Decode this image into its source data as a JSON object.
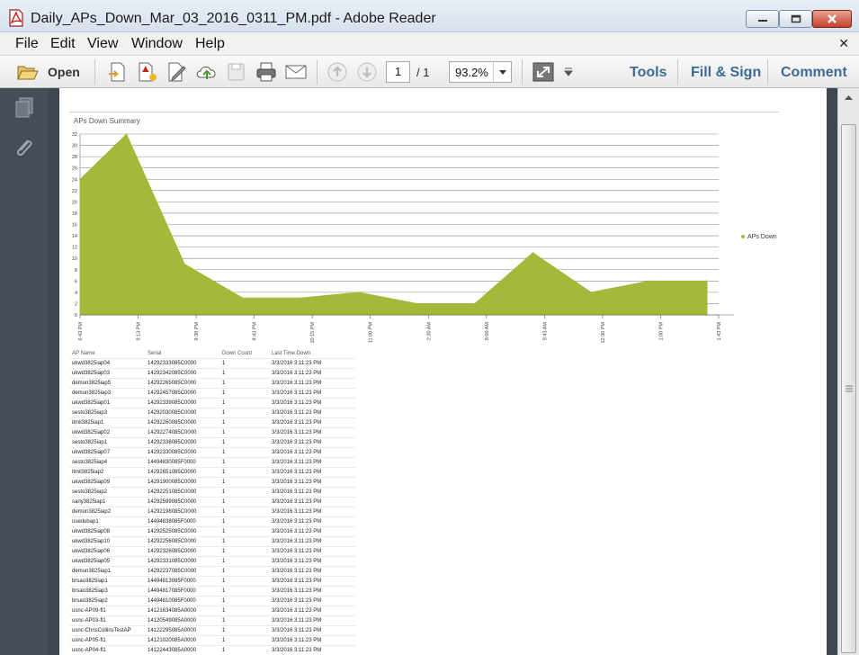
{
  "window": {
    "title": "Daily_APs_Down_Mar_03_2016_0311_PM.pdf - Adobe Reader"
  },
  "menu": [
    "File",
    "Edit",
    "View",
    "Window",
    "Help"
  ],
  "toolbar": {
    "open_label": "Open",
    "page_current": "1",
    "page_total": "/ 1",
    "zoom": "93.2%",
    "tools": "Tools",
    "fill_sign": "Fill & Sign",
    "comment": "Comment"
  },
  "chart_data": {
    "type": "area",
    "title": "APs Down Summary",
    "x_ticks": [
      "6:43 PM",
      "9:13 PM",
      "9:38 PM",
      "9:43 PM",
      "10:15 PM",
      "11:00 PM",
      "2:30 AM",
      "8:00 AM",
      "9:43 AM",
      "12:30 PM",
      "1:00 PM",
      "1:43 PM"
    ],
    "y_ticks": [
      0,
      2,
      4,
      6,
      8,
      10,
      12,
      14,
      16,
      18,
      20,
      22,
      24,
      26,
      28,
      30,
      32
    ],
    "ylim": [
      0,
      32
    ],
    "series": [
      {
        "name": "APs Down",
        "color": "#a6b83a",
        "points": [
          [
            0,
            24
          ],
          [
            0.8,
            32
          ],
          [
            1.8,
            9
          ],
          [
            2.8,
            3
          ],
          [
            3.8,
            3
          ],
          [
            4.8,
            4
          ],
          [
            5.8,
            2
          ],
          [
            6.8,
            2
          ],
          [
            7.8,
            11
          ],
          [
            8.8,
            4
          ],
          [
            9.8,
            6
          ],
          [
            10.8,
            6
          ]
        ]
      }
    ],
    "legend_position": "right"
  },
  "table": {
    "headers": [
      "AP Name",
      "Serial",
      "Down Count",
      "Last Time Down"
    ],
    "rows": [
      [
        "ukwd3825iap04",
        "14292333085C0000",
        "1",
        "3/3/2016 3:11:23 PM"
      ],
      [
        "ukwd3825iap03",
        "14292342085C0000",
        "1",
        "3/3/2016 3:11:23 PM"
      ],
      [
        "demun3825iap5",
        "14292265085C0000",
        "1",
        "3/3/2016 3:11:23 PM"
      ],
      [
        "demun3825iap3",
        "14292457085C0000",
        "1",
        "3/3/2016 3:11:23 PM"
      ],
      [
        "ukwd3825iap01",
        "14292339085C0000",
        "1",
        "3/3/2016 3:11:23 PM"
      ],
      [
        "sesto3825iap3",
        "14292030085C0000",
        "1",
        "3/3/2016 3:11:23 PM"
      ],
      [
        "itmil3825iap1",
        "14292260085C0000",
        "1",
        "3/3/2016 3:11:23 PM"
      ],
      [
        "ukwd3825iap02",
        "14292274085C0000",
        "1",
        "3/3/2016 3:11:23 PM"
      ],
      [
        "sesto3825iap1",
        "14292336085C0000",
        "1",
        "3/3/2016 3:11:23 PM"
      ],
      [
        "ukwd3825iap07",
        "14292330085C0000",
        "1",
        "3/3/2016 3:11:23 PM"
      ],
      [
        "sesto3825iap4",
        "14494830085F0000",
        "1",
        "3/3/2016 3:11:23 PM"
      ],
      [
        "itmil3825iap2",
        "14292651085C0000",
        "1",
        "3/3/2016 3:11:23 PM"
      ],
      [
        "ukwd3825iap09",
        "14291900085C0000",
        "1",
        "3/3/2016 3:11:23 PM"
      ],
      [
        "sesto3825iap2",
        "14292251085C0000",
        "1",
        "3/3/2016 3:11:23 PM"
      ],
      [
        "sarly3825iap1",
        "14292599085C0000",
        "1",
        "3/3/2016 3:11:23 PM"
      ],
      [
        "demun3825iap2",
        "14292198085C0000",
        "1",
        "3/3/2016 3:11:23 PM"
      ],
      [
        "usedubap1",
        "14494838085F0000",
        "1",
        "3/3/2016 3:11:23 PM"
      ],
      [
        "ukwd3825iap08",
        "14292525085C0000",
        "1",
        "3/3/2016 3:11:23 PM"
      ],
      [
        "ukwd3825iap10",
        "14292256085C0000",
        "1",
        "3/3/2016 3:11:23 PM"
      ],
      [
        "ukwd3825iap06",
        "14292326085C0000",
        "1",
        "3/3/2016 3:11:23 PM"
      ],
      [
        "ukwd3825iap05",
        "14292331085C0000",
        "1",
        "3/3/2016 3:11:23 PM"
      ],
      [
        "demun3825iap1",
        "14292237085C0000",
        "1",
        "3/3/2016 3:11:23 PM"
      ],
      [
        "brsao3825iap1",
        "14494813085F0000",
        "1",
        "3/3/2016 3:11:23 PM"
      ],
      [
        "brsao3825iap3",
        "14494817085F0000",
        "1",
        "3/3/2016 3:11:23 PM"
      ],
      [
        "brsao3825iap2",
        "14494810085F0000",
        "1",
        "3/3/2016 3:11:23 PM"
      ],
      [
        "usnc-AP09-fl1",
        "14121634085A0000",
        "1",
        "3/3/2016 3:11:23 PM"
      ],
      [
        "usnc-AP03-fl1",
        "14120549085A0000",
        "1",
        "3/3/2016 3:11:23 PM"
      ],
      [
        "usnc-ChrisCollinsTestAP",
        "14122295085A0000",
        "1",
        "3/3/2016 3:11:23 PM"
      ],
      [
        "usnc-AP05-fl1",
        "14121020085A0000",
        "1",
        "3/3/2016 3:11:23 PM"
      ],
      [
        "usnc-AP04-fl1",
        "14122443085A0000",
        "1",
        "3/3/2016 3:11:23 PM"
      ]
    ]
  }
}
